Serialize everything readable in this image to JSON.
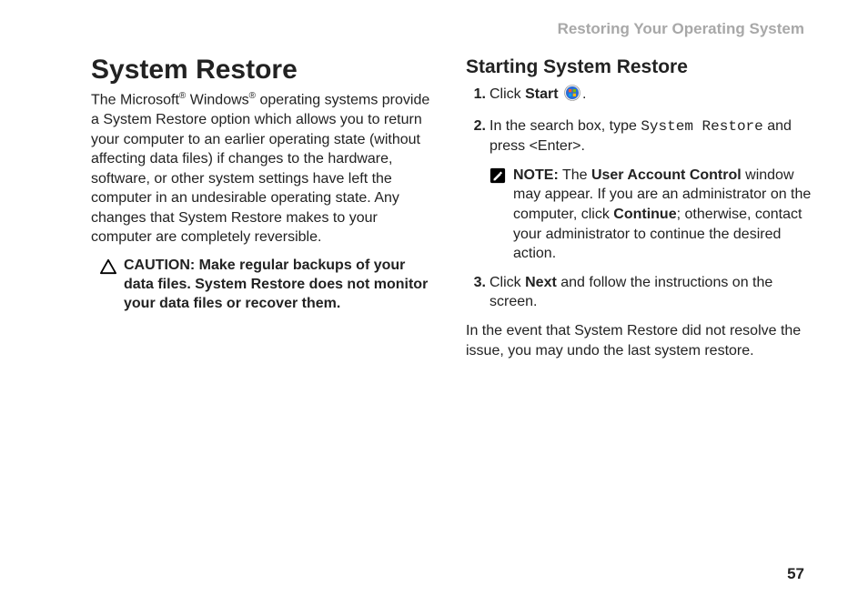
{
  "runningHead": "Restoring Your Operating System",
  "h1": "System Restore",
  "intro_head": "The Microsoft",
  "intro_mid": " Windows",
  "intro_tail": " operating systems provide a System Restore option which allows you to return your computer to an earlier operating state (without affecting data files) if changes to the hardware, software, or other system settings have left the computer in an undesirable operating state. Any changes that System Restore makes to your computer are completely reversible.",
  "caution_label": "CAUTION: ",
  "caution_text": "Make regular backups of your data files. System Restore does not monitor your data files or recover them.",
  "h2": "Starting System Restore",
  "step1_a": "Click ",
  "step1_b": "Start",
  "step1_c": " ",
  "step1_d": ".",
  "step2_a": "In the search box, type ",
  "step2_code": "System Restore",
  "step2_b": " and press <Enter>.",
  "note_label": "NOTE:",
  "note_a": " The ",
  "note_b1": "User Account Control",
  "note_b": " window may appear. If you are an administrator on the computer, click ",
  "note_b2": "Continue",
  "note_c": "; otherwise, contact your administrator to continue the desired action.",
  "step3_a": "Click ",
  "step3_b": "Next",
  "step3_c": " and follow the instructions on the screen.",
  "closing": "In the event that System Restore did not resolve the issue, you may undo the last system restore.",
  "reg": "®",
  "pageNum": "57"
}
